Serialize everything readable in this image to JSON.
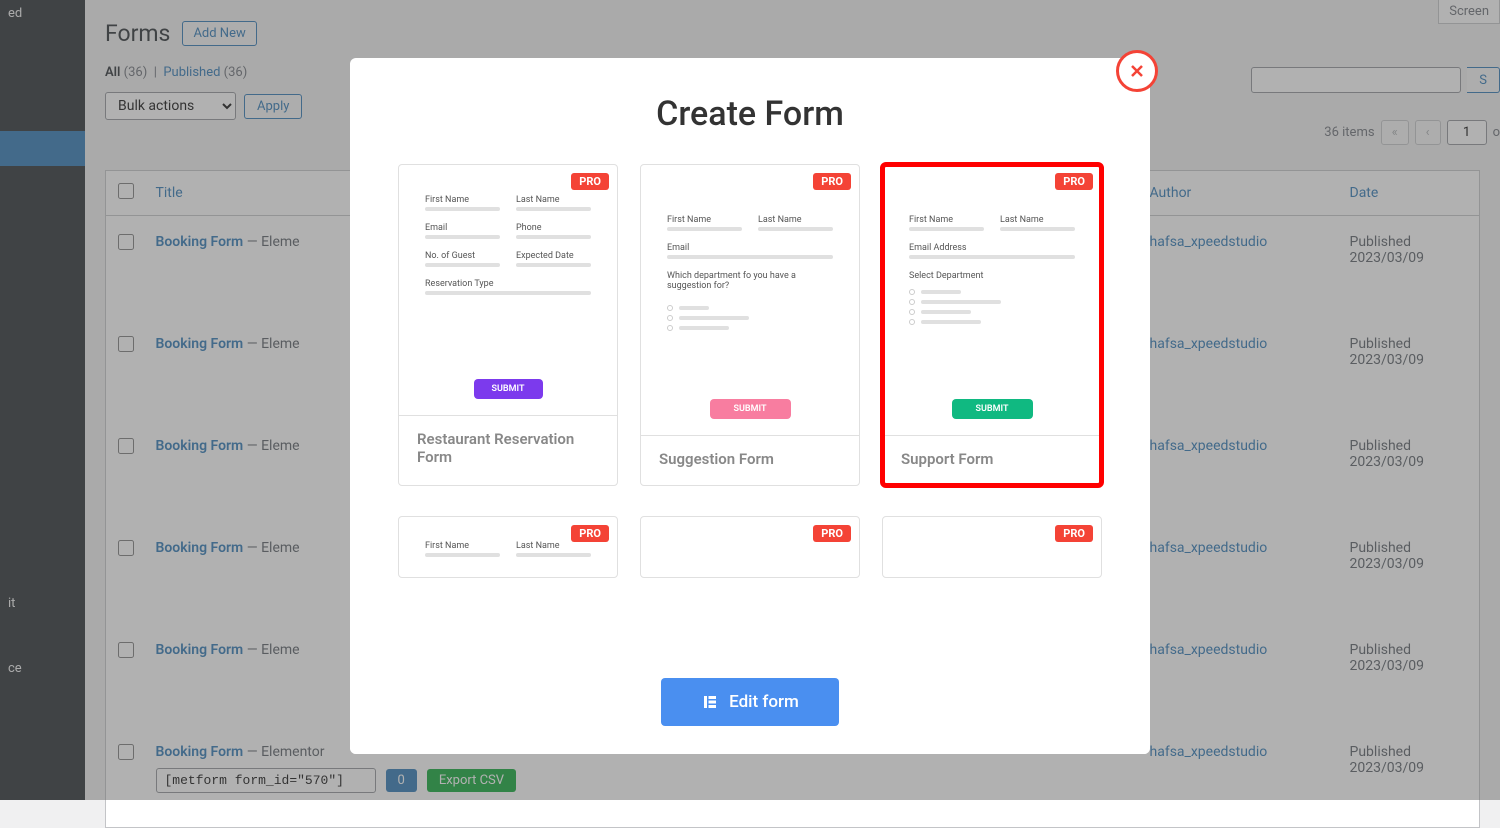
{
  "sidebar": {
    "items": [
      {
        "label": "ed"
      },
      {
        "label": ""
      },
      {
        "label": ""
      },
      {
        "label": ""
      },
      {
        "label": ""
      },
      {
        "label": ""
      },
      {
        "label": "it"
      },
      {
        "label": ""
      },
      {
        "label": "ce"
      }
    ]
  },
  "header": {
    "page_title": "Forms",
    "add_new": "Add New",
    "screen_options": "Screen"
  },
  "filters": {
    "all_label": "All",
    "all_count": "(36)",
    "published_label": "Published",
    "published_count": "(36)",
    "bulk_actions": "Bulk actions",
    "apply": "Apply"
  },
  "search": {
    "placeholder": ""
  },
  "pagination": {
    "items_label": "36 items",
    "current_page": "1",
    "prev_first": "«",
    "prev": "‹",
    "of": "o"
  },
  "table": {
    "columns": {
      "title": "Title",
      "author": "Author",
      "date": "Date"
    },
    "rows": [
      {
        "title": "Booking Form",
        "suffix": "— Eleme",
        "author": "hafsa_xpeedstudio",
        "status": "Published",
        "date": "2023/03/09"
      },
      {
        "title": "Booking Form",
        "suffix": "— Eleme",
        "author": "hafsa_xpeedstudio",
        "status": "Published",
        "date": "2023/03/09"
      },
      {
        "title": "Booking Form",
        "suffix": "— Eleme",
        "author": "hafsa_xpeedstudio",
        "status": "Published",
        "date": "2023/03/09"
      },
      {
        "title": "Booking Form",
        "suffix": "— Eleme",
        "author": "hafsa_xpeedstudio",
        "status": "Published",
        "date": "2023/03/09"
      },
      {
        "title": "Booking Form",
        "suffix": "— Eleme",
        "author": "hafsa_xpeedstudio",
        "status": "Published",
        "date": "2023/03/09"
      },
      {
        "title": "Booking Form",
        "suffix": "— Elementor",
        "author": "hafsa_xpeedstudio",
        "status": "Published",
        "date": "2023/03/09"
      }
    ],
    "shortcode": "[metform form_id=\"570\"]",
    "entries": "0",
    "export": "Export CSV"
  },
  "modal": {
    "title": "Create Form",
    "edit_button": "Edit form",
    "pro_badge": "PRO",
    "templates": [
      {
        "name": "Restaurant Reservation Form",
        "fields_row1": [
          "First Name",
          "Last Name"
        ],
        "fields_row2": [
          "Email",
          "Phone"
        ],
        "fields_row3": [
          "No. of Guest",
          "Expected Date"
        ],
        "field_full": "Reservation Type",
        "submit": "SUBMIT",
        "btn_color": "purple"
      },
      {
        "name": "Suggestion Form",
        "fields_row1": [
          "First Name",
          "Last Name"
        ],
        "field_email": "Email",
        "question": "Which department fo you have a suggestion for?",
        "submit": "SUBMIT",
        "btn_color": "pink"
      },
      {
        "name": "Support Form",
        "fields_row1": [
          "First Name",
          "Last Name"
        ],
        "field_email": "Email Address",
        "field_dept": "Select Department",
        "submit": "SUBMIT",
        "btn_color": "green"
      }
    ],
    "templates_row2_fields": [
      "First Name",
      "Last Name"
    ]
  }
}
